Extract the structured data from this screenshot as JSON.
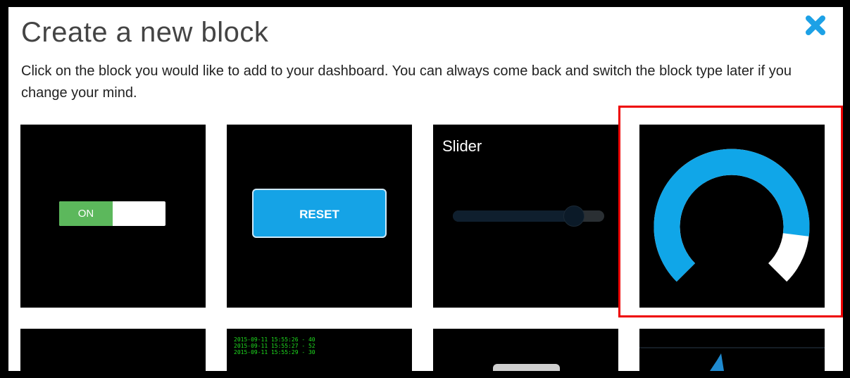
{
  "dialog": {
    "title": "Create a new block",
    "description": "Click on the block you would like to add to your dashboard. You can always come back and switch the block type later if you change your mind.",
    "close_icon": "close-x-icon",
    "accent_color": "#1da1e6",
    "highlight_color": "#e00000"
  },
  "blocks": {
    "toggle": {
      "on_label": "ON",
      "on_color": "#5cb85c"
    },
    "momentary": {
      "label": "RESET",
      "color": "#15a3e6"
    },
    "slider": {
      "label": "Slider",
      "value_fraction": 0.8
    },
    "gauge": {
      "value_fraction": 0.86,
      "color": "#10a6e8"
    },
    "stream": {
      "line_partial": "2015-09-11 15:55:26 - 40",
      "lines": [
        "2015-09-11 15:55:27 - 52",
        "2015-09-11 15:55:29 - 30"
      ]
    }
  }
}
